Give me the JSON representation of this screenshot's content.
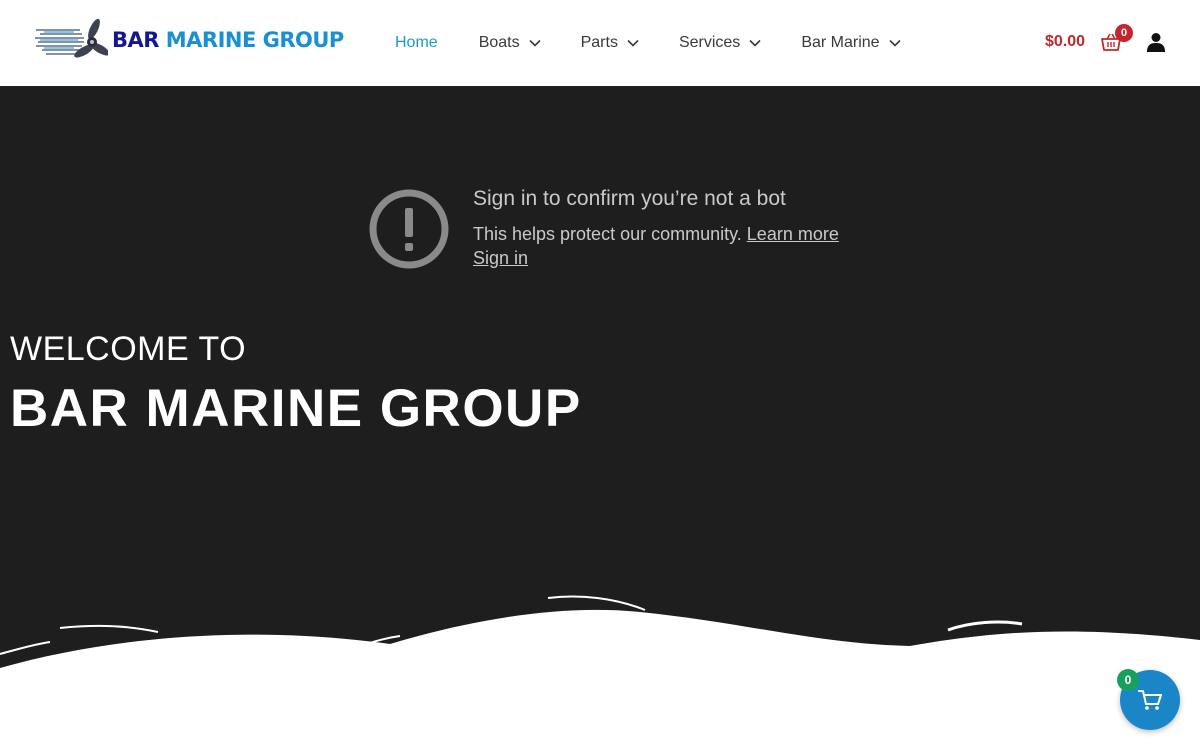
{
  "header": {
    "logo": {
      "word1": "BAR",
      "word2": "MARINE GROUP"
    },
    "nav": [
      {
        "label": "Home",
        "active": true
      },
      {
        "label": "Boats",
        "has_dropdown": true
      },
      {
        "label": "Parts",
        "has_dropdown": true
      },
      {
        "label": "Services",
        "has_dropdown": true
      },
      {
        "label": "Bar Marine",
        "has_dropdown": true
      }
    ],
    "cart_total": "$0.00",
    "cart_count": "0",
    "icons": {
      "cart": "basket-icon",
      "account": "user-icon",
      "dropdown": "chevron-down-icon"
    }
  },
  "hero": {
    "bot_notice": {
      "title": "Sign in to confirm you’re not a bot",
      "description": "This helps protect our community.",
      "learn_more": "Learn more",
      "sign_in": "Sign in"
    },
    "welcome": "WELCOME TO",
    "brand": "BAR MARINE GROUP"
  },
  "floating_cart": {
    "count": "0"
  },
  "colors": {
    "nav_active": "#1a9ac9",
    "cart_red": "#c1282d",
    "hero_bg": "#1e1e1e",
    "float_cart_blue": "#1a86c8",
    "float_badge_green": "#17a05d",
    "logo_navy": "#15188c",
    "logo_blue": "#1b8fd3"
  }
}
